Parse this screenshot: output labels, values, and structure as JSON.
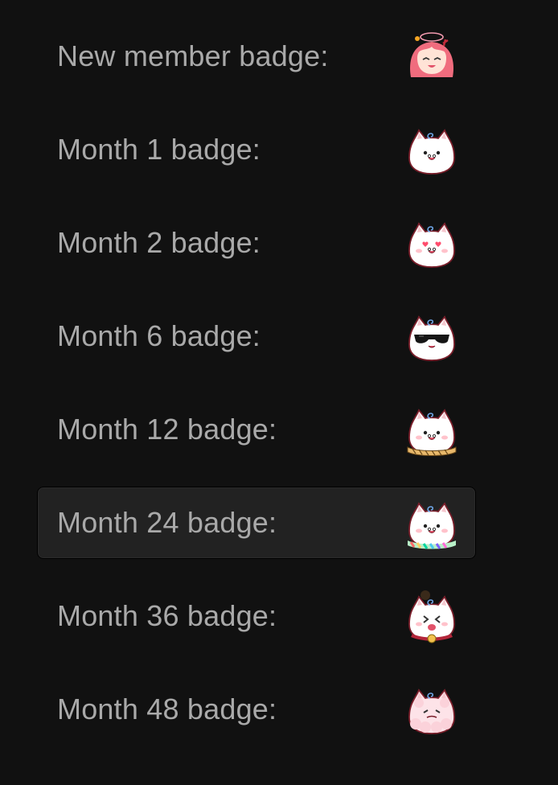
{
  "badges": [
    {
      "label": "New member badge:",
      "icon": "anime-girl-icon",
      "variant": "girl",
      "selected": false
    },
    {
      "label": "Month 1 badge:",
      "icon": "white-cat-icon",
      "variant": "plain",
      "selected": false
    },
    {
      "label": "Month 2 badge:",
      "icon": "heart-eyes-cat-icon",
      "variant": "hearts",
      "selected": false
    },
    {
      "label": "Month 6 badge:",
      "icon": "sunglasses-cat-icon",
      "variant": "sunglasses",
      "selected": false
    },
    {
      "label": "Month 12 badge:",
      "icon": "rope-cat-icon",
      "variant": "rope",
      "selected": false
    },
    {
      "label": "Month 24 badge:",
      "icon": "rainbow-rope-cat-icon",
      "variant": "rainbow",
      "selected": true
    },
    {
      "label": "Month 36 badge:",
      "icon": "bell-cat-icon",
      "variant": "bell",
      "selected": false
    },
    {
      "label": "Month 48 badge:",
      "icon": "fluffy-cat-icon",
      "variant": "fluffy",
      "selected": false
    }
  ],
  "colors": {
    "background": "#111111",
    "label_text": "#a9a9a9",
    "selected_row": "#222222",
    "cat_body": "#ffffff",
    "cat_outline": "#7a1f2b",
    "cheek": "#ff9aa8",
    "hair": "#f06c7e"
  }
}
